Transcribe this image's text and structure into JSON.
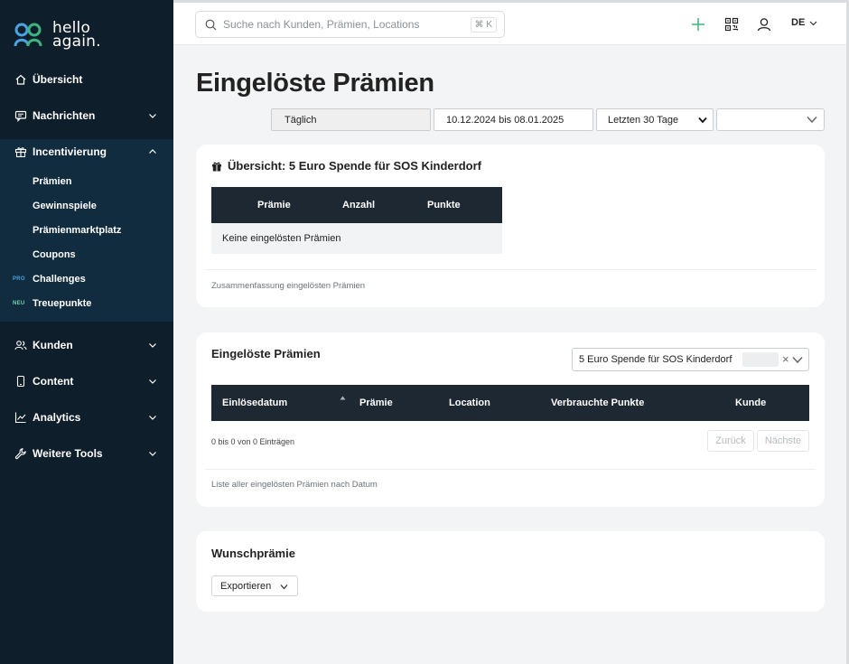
{
  "brand": {
    "line1": "hello",
    "line2": "again."
  },
  "colors": {
    "sidebar": "#0f1e2b",
    "sidebar_active": "#112c3f",
    "accent_green": "#3fb37f",
    "table_header": "#1e2832"
  },
  "sidebar": {
    "items": [
      {
        "label": "Übersicht",
        "icon": "home-icon"
      },
      {
        "label": "Nachrichten",
        "icon": "message-icon"
      },
      {
        "label": "Incentivierung",
        "icon": "gift-icon"
      },
      {
        "label": "Kunden",
        "icon": "users-icon"
      },
      {
        "label": "Content",
        "icon": "phone-icon"
      },
      {
        "label": "Analytics",
        "icon": "chart-icon"
      },
      {
        "label": "Weitere Tools",
        "icon": "wrench-icon"
      }
    ],
    "subitems": [
      "Prämien",
      "Gewinnspiele",
      "Prämienmarktplatz",
      "Coupons",
      "Challenges",
      "Treuepunkte"
    ],
    "badges": {
      "pro": "PRO",
      "new": "NEU"
    }
  },
  "topbar": {
    "search_placeholder": "Suche nach Kunden, Prämien, Locations",
    "search_shortcut": "⌘ K",
    "language": "DE"
  },
  "page": {
    "title": "Eingelöste Prämien",
    "filters": {
      "interval": "Täglich",
      "date_range": "10.12.2024 bis 08.01.2025",
      "period_select": "Letzten 30 Tage",
      "extra_select": ""
    }
  },
  "overview_card": {
    "title": "Übersicht: 5 Euro Spende für SOS Kinderdorf",
    "columns": [
      "Prämie",
      "Anzahl",
      "Punkte"
    ],
    "empty_message": "Keine eingelösten Prämien",
    "footer": "Zusammenfassung eingelösten Prämien"
  },
  "redeemed_card": {
    "title": "Eingelöste Prämien",
    "selected_reward": "5 Euro Spende für SOS Kinderdorf",
    "clear": "×",
    "columns": [
      "Einlösedatum",
      "Prämie",
      "Location",
      "Verbrauchte Punkte",
      "Kunde"
    ],
    "entries_info": "0 bis 0 von 0 Einträgen",
    "prev_label": "Zurück",
    "next_label": "Nächste",
    "footer": "Liste aller eingelösten Prämien nach Datum"
  },
  "wish_card": {
    "title": "Wunschprämie",
    "export_label": "Exportieren"
  }
}
